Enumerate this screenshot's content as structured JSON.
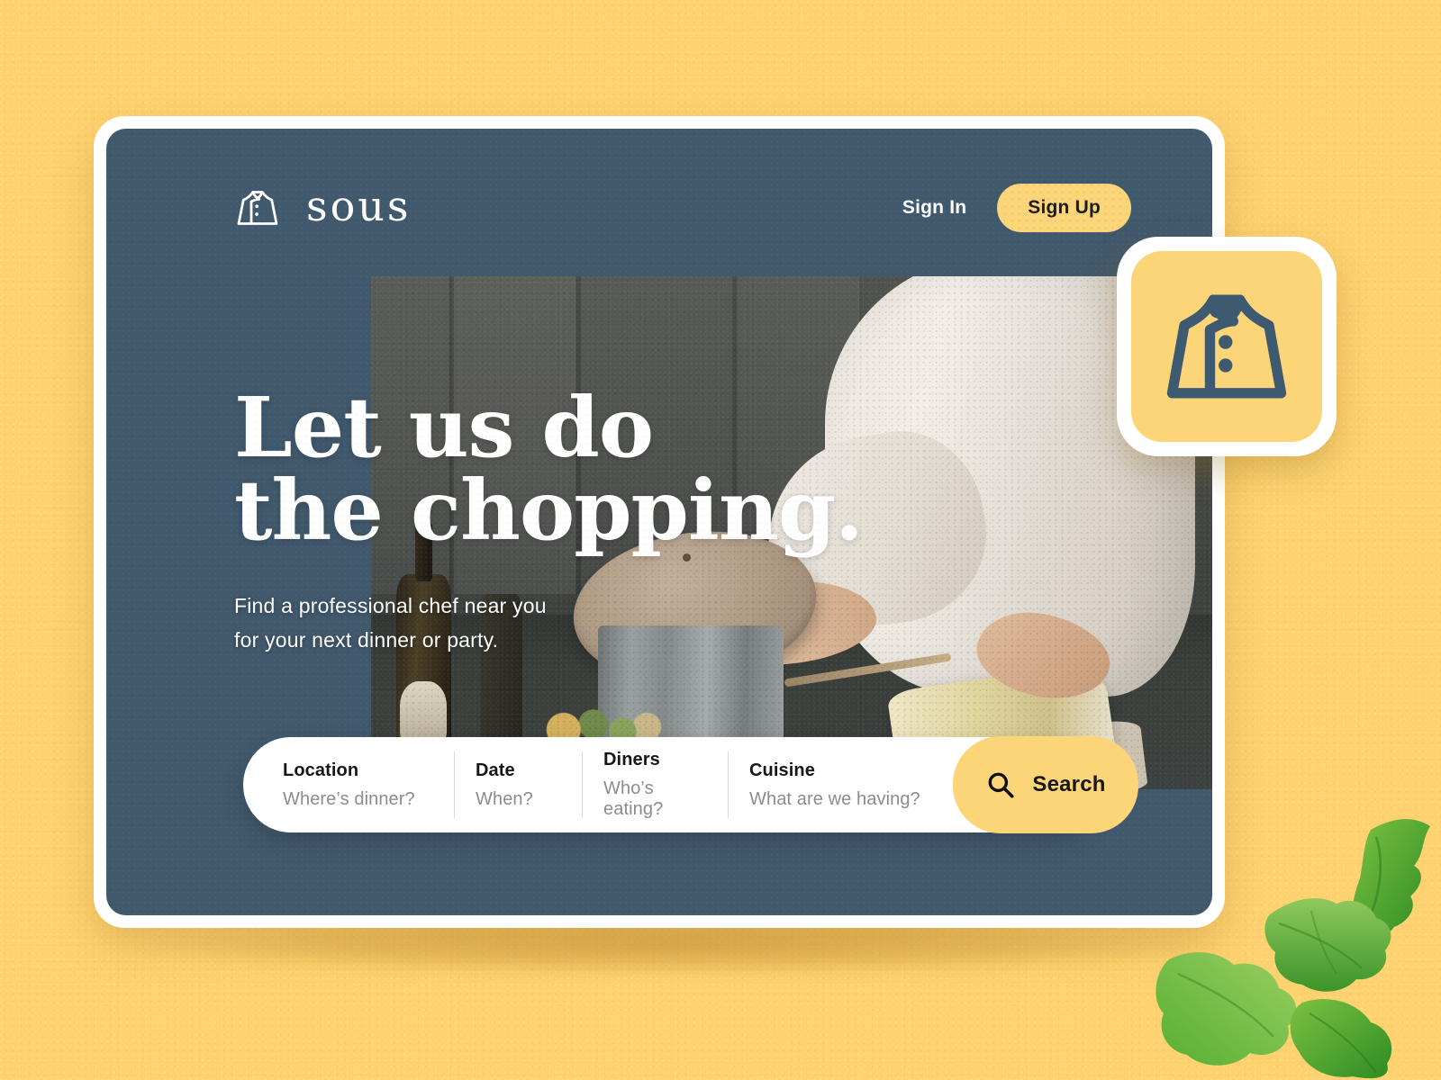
{
  "theme": {
    "background_yellow": "#FFD26F",
    "card_slate": "#41596D",
    "accent_yellow": "#FCD578",
    "white": "#FFFFFF",
    "text_dark": "#15171A",
    "placeholder_grey": "#8A8C8F"
  },
  "header": {
    "brand_name": "sous",
    "brand_icon": "chef-jacket-icon",
    "sign_in_label": "Sign In",
    "sign_up_label": "Sign Up"
  },
  "hero": {
    "title": "Let us do\nthe chopping.",
    "subtitle": "Find a professional chef near you\nfor your next dinner or party.",
    "photo_alt": "chef-in-white-coat-lifting-pot-lid-in-kitchen"
  },
  "search": {
    "fields": [
      {
        "label": "Location",
        "value": "Where’s dinner?"
      },
      {
        "label": "Date",
        "value": "When?"
      },
      {
        "label": "Diners",
        "value": "Who’s eating?"
      },
      {
        "label": "Cuisine",
        "value": "What are we having?"
      }
    ],
    "button_label": "Search",
    "button_icon": "search-icon"
  },
  "badge": {
    "icon": "chef-jacket-icon"
  },
  "decoration": {
    "garnish": "parsley-leaves"
  }
}
